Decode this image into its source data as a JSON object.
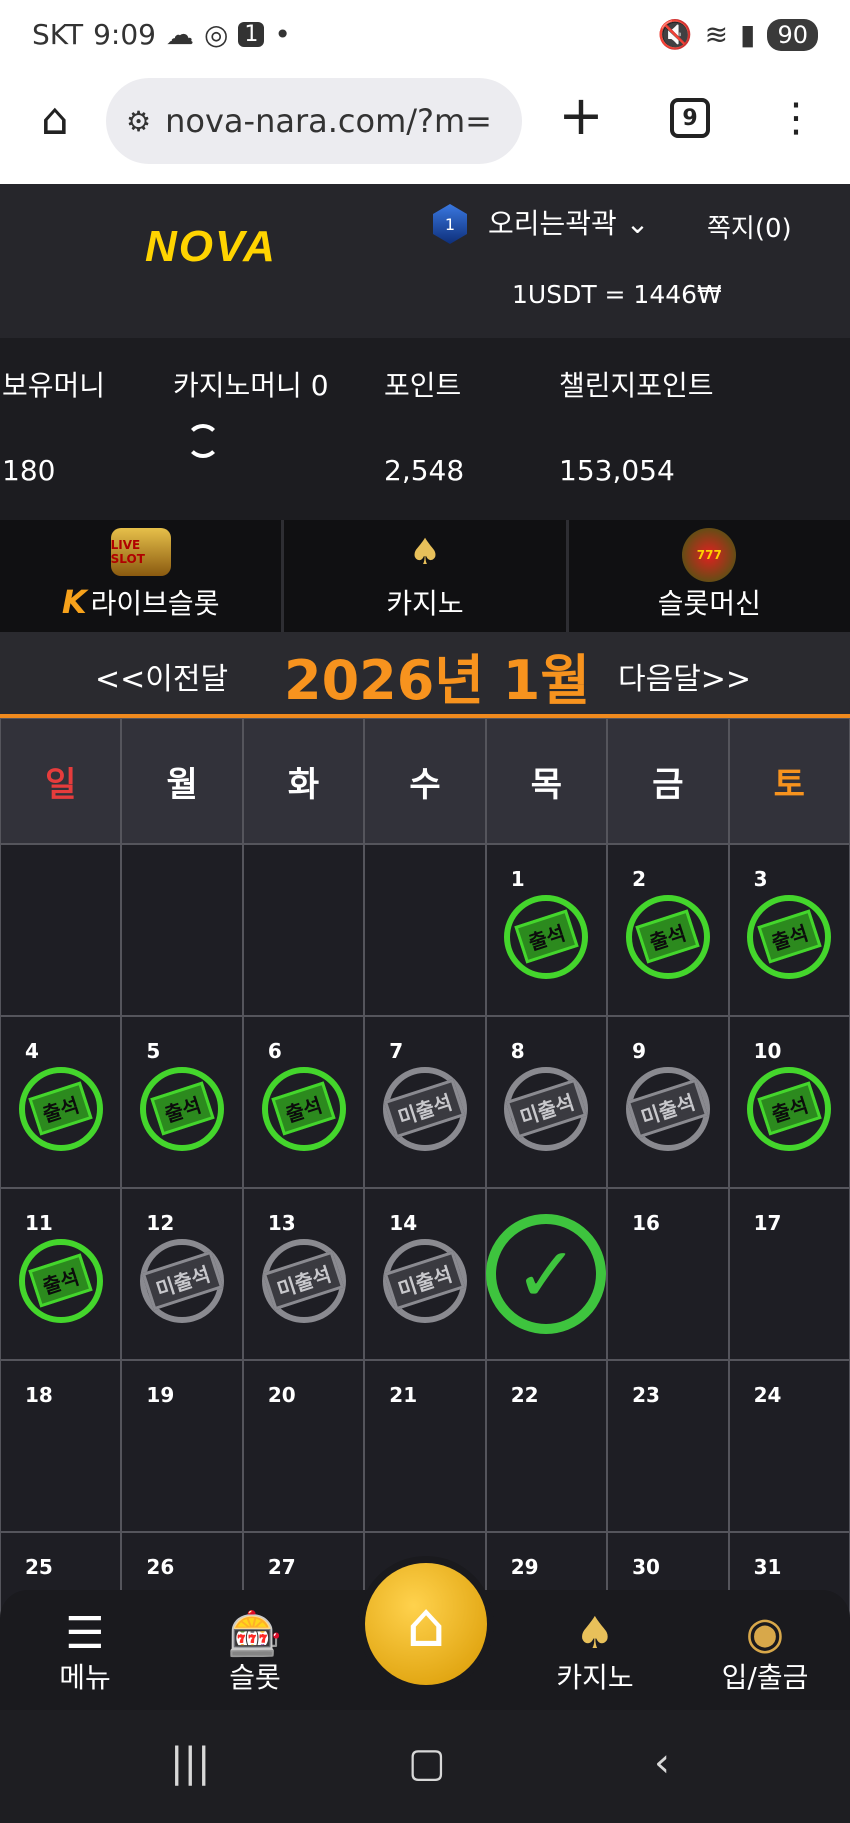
{
  "status_bar": {
    "carrier": "SKT",
    "time": "9:09",
    "notification_badge": "1",
    "battery": "90"
  },
  "browser": {
    "url": "nova-nara.com/?m=",
    "tab_count": "9"
  },
  "header": {
    "logo": "NOVA",
    "username": "오리는곽곽",
    "rank_level": "1",
    "messages": "쪽지(0)",
    "exchange_rate": "1USDT = 1446₩"
  },
  "balances": {
    "holding_money_label": "보유머니",
    "holding_money_value": "180",
    "casino_money_label": "카지노머니 0",
    "points_label": "포인트",
    "points_value": "2,548",
    "challenge_points_label": "챌린지포인트",
    "challenge_points_value": "153,054"
  },
  "game_tabs": [
    {
      "label": "라이브슬롯",
      "icon": "live-slot-icon",
      "icon_text": "LIVE SLOT",
      "badge": "K"
    },
    {
      "label": "카지노",
      "icon": "kslot-icon"
    },
    {
      "label": "슬롯머신",
      "icon": "777-slots-icon",
      "icon_text": "777"
    }
  ],
  "calendar": {
    "prev": "<<이전달",
    "title": "2026년 1월",
    "next": "다음달>>",
    "weekdays": [
      "일",
      "월",
      "화",
      "수",
      "목",
      "금",
      "토"
    ],
    "present_label": "출석",
    "absent_label": "미출석",
    "days": {
      "d1": "1",
      "d2": "2",
      "d3": "3",
      "d4": "4",
      "d5": "5",
      "d6": "6",
      "d7": "7",
      "d8": "8",
      "d9": "9",
      "d10": "10",
      "d11": "11",
      "d12": "12",
      "d13": "13",
      "d14": "14",
      "d16": "16",
      "d17": "17",
      "d18": "18",
      "d19": "19",
      "d20": "20",
      "d21": "21",
      "d22": "22",
      "d23": "23",
      "d24": "24",
      "d25": "25",
      "d26": "26",
      "d27": "27",
      "d29": "29",
      "d30": "30",
      "d31": "31"
    },
    "attendance": {
      "present": [
        1,
        2,
        3,
        4,
        5,
        6,
        10,
        11
      ],
      "absent": [
        7,
        8,
        9,
        12,
        13,
        14
      ],
      "today": 15
    }
  },
  "bottom_nav": {
    "menu": "메뉴",
    "slot": "슬롯",
    "casino": "카지노",
    "deposit_withdraw": "입/출금"
  },
  "colors": {
    "accent": "#f7931e",
    "present": "#44d62c",
    "sunday": "#e63c3c"
  }
}
